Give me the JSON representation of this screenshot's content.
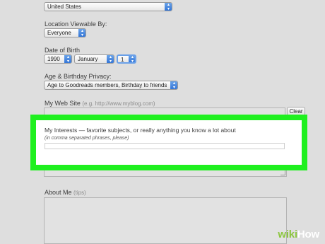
{
  "country": {
    "value": "United States"
  },
  "location_viewable": {
    "label": "Location Viewable By:",
    "value": "Everyone"
  },
  "date_of_birth": {
    "label": "Date of Birth",
    "year": "1990",
    "month": "January",
    "day": "1"
  },
  "privacy": {
    "label": "Age & Birthday Privacy:",
    "value": "Age to Goodreads members, Birthday to friends"
  },
  "website": {
    "label": "My Web Site",
    "hint": "(e.g. http://www.myblog.com)",
    "clear_label": "Clear"
  },
  "interests": {
    "label": "My Interests — favorite subjects, or really anything you know a lot about",
    "hint": "(in comma separated phrases, please)",
    "value": ""
  },
  "about": {
    "label": "About Me",
    "hint": "(tips)"
  },
  "watermark": {
    "wiki": "wiki",
    "how": "How"
  },
  "colors": {
    "highlight": "#1ff01f",
    "select_arrow": "#2f72d6",
    "watermark_wiki": "#8cc63f"
  }
}
